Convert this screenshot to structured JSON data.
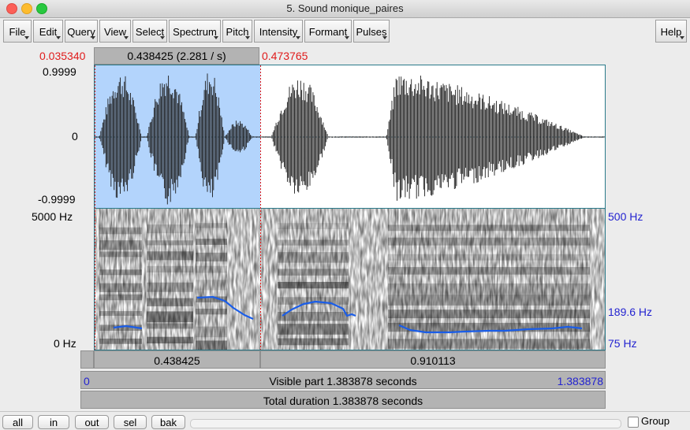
{
  "window": {
    "title": "5. Sound monique_paires"
  },
  "menus": [
    "File",
    "Edit",
    "Query",
    "View",
    "Select",
    "Spectrum",
    "Pitch",
    "Intensity",
    "Formant",
    "Pulses"
  ],
  "help_label": "Help",
  "selection": {
    "start": "0.035340",
    "end": "0.473765",
    "duration_label": "0.438425 (2.281 / s)"
  },
  "waveform": {
    "y_top": "0.9999",
    "y_zero": "0",
    "y_bottom": "-0.9999"
  },
  "spectrogram": {
    "freq_top": "5000 Hz",
    "freq_bottom": "0 Hz"
  },
  "pitch_axis": {
    "top": "500 Hz",
    "mid": "189.6 Hz",
    "bottom": "75 Hz"
  },
  "segments": {
    "left": "",
    "sel": "0.438425",
    "right": "0.910113"
  },
  "visible": {
    "start": "0",
    "label": "Visible part 1.383878 seconds",
    "end": "1.383878"
  },
  "total": {
    "label": "Total duration 1.383878 seconds"
  },
  "buttons": {
    "all": "all",
    "in": "in",
    "out": "out",
    "sel": "sel",
    "bak": "bak"
  },
  "group_label": "Group",
  "colors": {
    "selection": "#b3d4fc",
    "pitch": "#1a5de8",
    "cursor": "#e01b1b"
  }
}
